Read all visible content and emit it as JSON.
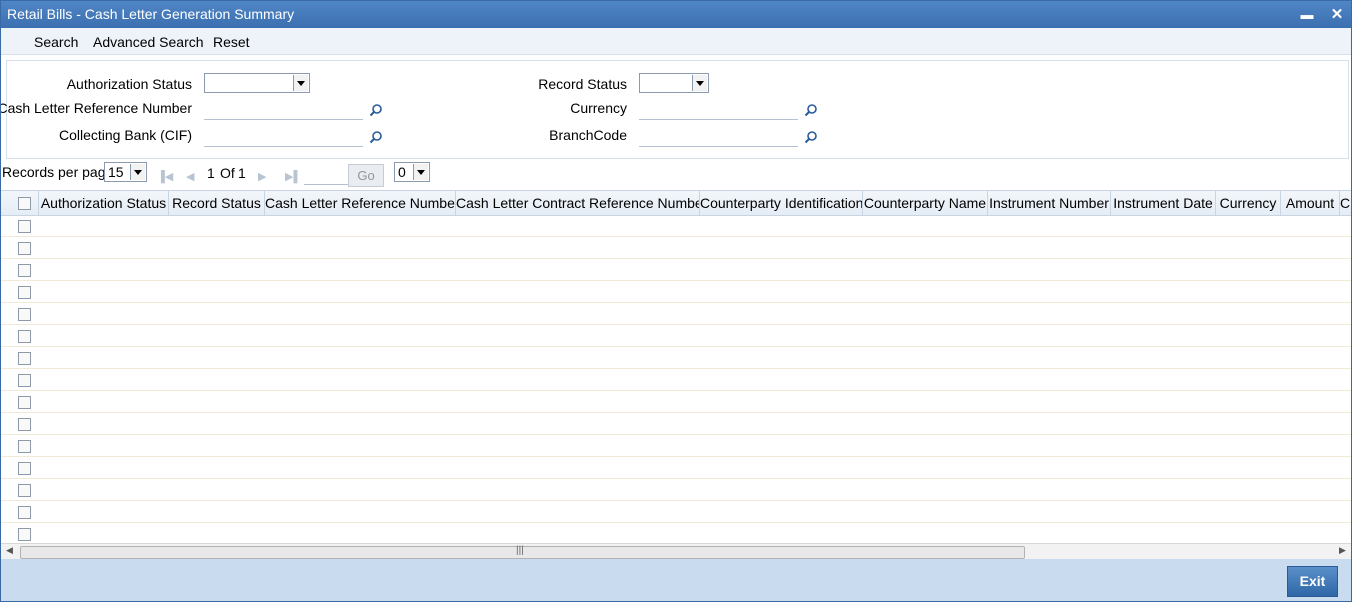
{
  "window": {
    "title": "Retail Bills - Cash Letter Generation Summary",
    "minimize_label": "▬",
    "close_label": "✕"
  },
  "menu": {
    "search": "Search",
    "advanced_search": "Advanced Search",
    "reset": "Reset"
  },
  "criteria": {
    "authorization_status": {
      "label": "Authorization Status",
      "value": ""
    },
    "record_status": {
      "label": "Record Status",
      "value": ""
    },
    "cash_letter_reference_number": {
      "label": "Cash Letter Reference Number",
      "value": ""
    },
    "currency": {
      "label": "Currency",
      "value": ""
    },
    "collecting_bank": {
      "label": "Collecting Bank (CIF)",
      "value": ""
    },
    "branch_code": {
      "label": "BranchCode",
      "value": ""
    }
  },
  "pager": {
    "records_per_page_label": "Records per page",
    "records_per_page_value": "15",
    "current_page": "1",
    "of_label": "Of",
    "total_pages": "1",
    "go_label": "Go",
    "page_jump_value": "0"
  },
  "grid": {
    "columns": [
      "Authorization Status",
      "Record Status",
      "Cash Letter Reference Number",
      "Cash Letter Contract Reference Number",
      "Counterparty Identification",
      "Counterparty Name",
      "Instrument Number",
      "Instrument Date",
      "Currency",
      "Amount",
      "C"
    ],
    "row_count": 15
  },
  "footer": {
    "exit_label": "Exit"
  },
  "colors": {
    "titlebar": "#3c6fb0",
    "footer": "#c9dcef",
    "exit_button": "#2f67a8"
  }
}
